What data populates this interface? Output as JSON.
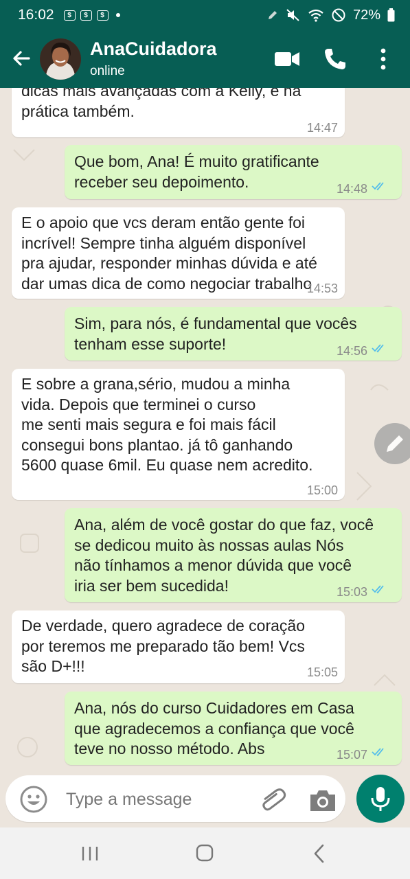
{
  "status_bar": {
    "time": "16:02",
    "notification_icons": [
      "$",
      "$",
      "$"
    ],
    "battery": "72%"
  },
  "header": {
    "contact_name": "AnaCuidadora",
    "contact_status": "online"
  },
  "messages": [
    {
      "direction": "in",
      "lines": [
        "dicas mais avançadas com a Kelly, e na",
        "prática também."
      ],
      "time": "14:47"
    },
    {
      "direction": "out",
      "lines": [
        "Que bom, Ana! É muito gratificante",
        "receber seu depoimento."
      ],
      "time": "14:48",
      "status": "read"
    },
    {
      "direction": "in",
      "lines": [
        "E o apoio que vcs deram então gente foi",
        "incrível! Sempre tinha alguém disponível",
        "pra ajudar, responder minhas dúvida e até",
        "dar umas dica de como negociar trabalho"
      ],
      "time": "14:53"
    },
    {
      "direction": "out",
      "lines": [
        "Sim, para nós, é fundamental que vocês",
        "tenham esse suporte!"
      ],
      "time": "14:56",
      "status": "read"
    },
    {
      "direction": "in",
      "lines": [
        "E sobre a grana,sério, mudou a minha",
        "vida. Depois que terminei o curso",
        "me senti mais segura e foi mais fácil",
        "consegui bons plantao. já tô ganhando",
        "5600 quase 6mil. Eu quase nem acredito."
      ],
      "time": "15:00"
    },
    {
      "direction": "out",
      "lines": [
        "Ana, além de você gostar do que faz, você",
        "se dedicou muito às nossas aulas  Nós",
        "não tínhamos a menor dúvida que você",
        "iria ser bem sucedida!"
      ],
      "time": "15:03",
      "status": "read"
    },
    {
      "direction": "in",
      "lines": [
        "De verdade, quero agradece de coração",
        "por teremos me preparado tão bem! Vcs",
        "são D+!!!"
      ],
      "time": "15:05"
    },
    {
      "direction": "out",
      "lines": [
        "Ana, nós do curso Cuidadores em Casa",
        "que agradecemos a confiança que você",
        "teve no nosso método. Abs"
      ],
      "time": "15:07",
      "status": "read"
    }
  ],
  "composer": {
    "placeholder": "Type a message"
  },
  "icons": {
    "back": "back-arrow-icon",
    "video_call": "video-camera-icon",
    "voice_call": "phone-icon",
    "menu": "more-vert-icon",
    "emoji": "emoji-icon",
    "attach": "paperclip-icon",
    "camera": "camera-icon",
    "mic": "microphone-icon",
    "edit": "pencil-icon"
  },
  "colors": {
    "header": "#075e54",
    "outgoing_bubble": "#dcf8c6",
    "incoming_bubble": "#ffffff",
    "chat_background": "#ece5dd",
    "read_ticks": "#53bdeb",
    "mic_button": "#00806e"
  }
}
